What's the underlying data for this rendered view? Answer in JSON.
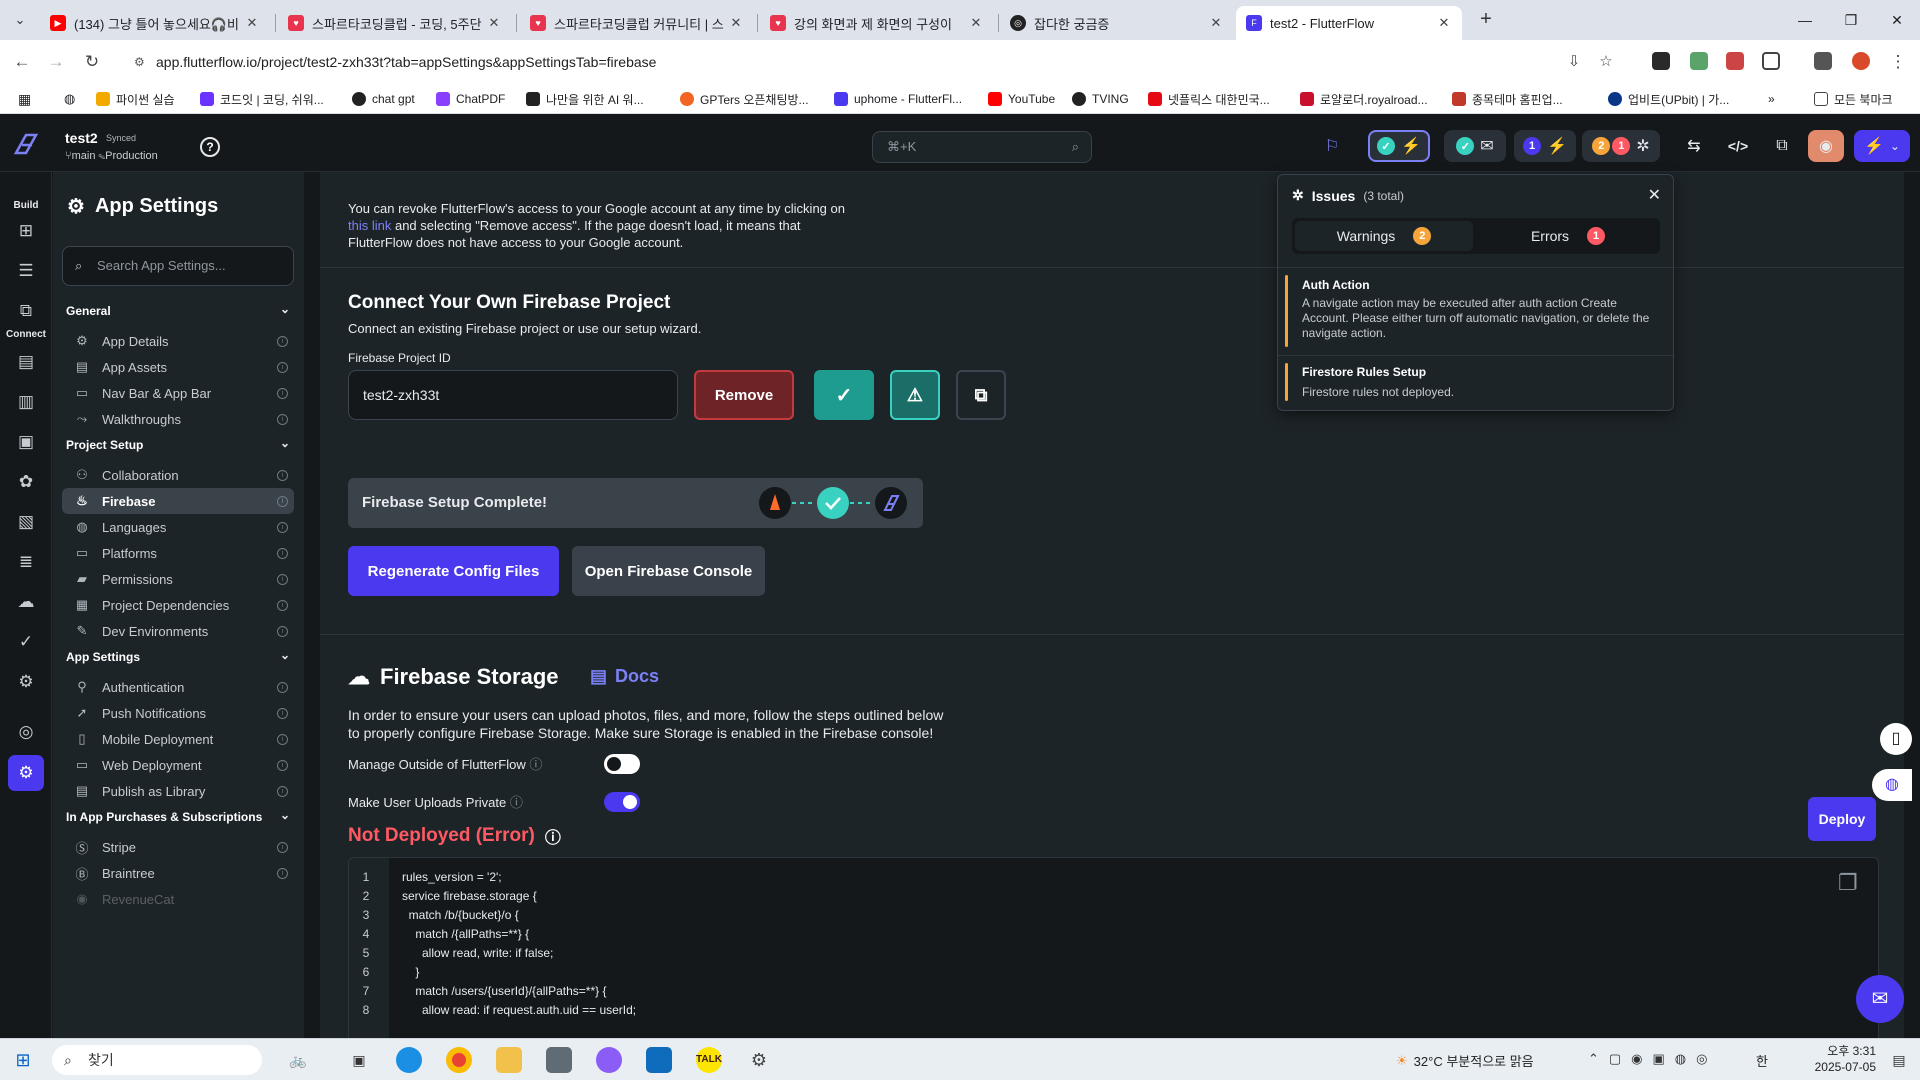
{
  "browser": {
    "tabs": [
      {
        "title": "(134) 그냥 틀어 놓으세요🎧비",
        "favicon": "youtube-icon"
      },
      {
        "title": "스파르타코딩클럽 - 코딩, 5주단",
        "favicon": "sparta-icon"
      },
      {
        "title": "스파르타코딩클럽 커뮤니티 | 스",
        "favicon": "sparta-icon"
      },
      {
        "title": "강의 화면과 제 화면의 구성이",
        "favicon": "sparta-icon"
      },
      {
        "title": "잡다한 궁금증",
        "favicon": "chatgpt-icon"
      },
      {
        "title": "test2 - FlutterFlow",
        "favicon": "flutterflow-icon"
      }
    ],
    "url": "app.flutterflow.io/project/test2-zxh33t?tab=appSettings&appSettingsTab=firebase",
    "bookmarks": [
      "파이썬 실습",
      "코드잇 | 코딩, 쉬워...",
      "chat gpt",
      "ChatPDF",
      "나만을 위한 AI 워...",
      "GPTers 오픈채팅방...",
      "uphome - FlutterFl...",
      "YouTube",
      "TVING",
      "넷플릭스 대한민국...",
      "로얄로더.royalroad...",
      "종목테마 홈핀업...",
      "업비트(UPbit) | 가...",
      "모든 북마크"
    ]
  },
  "topbar": {
    "project_name": "test2",
    "synced_label": "Synced",
    "branch_label": "main",
    "env_label": "Production",
    "search_shortcut": "⌘+K",
    "warnings_count": "2",
    "errors_count": "1",
    "notifications_count": "1"
  },
  "rail": {
    "build_label": "Build",
    "connect_label": "Connect"
  },
  "sidebar": {
    "title": "App Settings",
    "search_placeholder": "Search App Settings...",
    "sections": {
      "general": "General",
      "project_setup": "Project Setup",
      "app_settings": "App Settings",
      "purchases": "In App Purchases & Subscriptions"
    },
    "general_items": [
      "App Details",
      "App Assets",
      "Nav Bar & App Bar",
      "Walkthroughs"
    ],
    "project_items": [
      "Collaboration",
      "Firebase",
      "Languages",
      "Platforms",
      "Permissions",
      "Project Dependencies",
      "Dev Environments"
    ],
    "app_items": [
      "Authentication",
      "Push Notifications",
      "Mobile Deployment",
      "Web Deployment",
      "Publish as Library"
    ],
    "purchase_items": [
      "Stripe",
      "Braintree",
      "RevenueCat"
    ]
  },
  "main": {
    "revoke_text_1": "You can revoke FlutterFlow's access to your Google account at any time by clicking on",
    "revoke_link": "this link",
    "revoke_text_2": " and selecting \"Remove access\". If the page doesn't load, it means that",
    "revoke_text_3": "FlutterFlow does not have access to your Google account.",
    "connect_title": "Connect Your Own Firebase Project",
    "connect_subtitle": "Connect an existing Firebase project or use our setup wizard.",
    "project_id_label": "Firebase Project ID",
    "project_id_value": "test2-zxh33t",
    "remove_label": "Remove",
    "setup_complete_label": "Firebase Setup Complete!",
    "regenerate_label": "Regenerate Config Files",
    "open_console_label": "Open Firebase Console",
    "storage_title": "Firebase Storage",
    "docs_label": "Docs",
    "storage_desc_1": "In order to ensure your users can upload photos, files, and more, follow the steps outlined below",
    "storage_desc_2": "to properly configure Firebase Storage. Make sure Storage is enabled in the Firebase console!",
    "manage_outside_label": "Manage Outside of FlutterFlow",
    "manage_outside_on": false,
    "private_uploads_label": "Make User Uploads Private",
    "private_uploads_on": true,
    "deploy_status": "Not Deployed (Error)",
    "deploy_label": "Deploy",
    "code_lines": [
      "rules_version = '2';",
      "service firebase.storage {",
      "  match /b/{bucket}/o {",
      "    match /{allPaths=**} {",
      "      allow read, write: if false;",
      "    }",
      "    match /users/{userId}/{allPaths=**} {",
      "      allow read: if request.auth.uid == userId;"
    ]
  },
  "issues": {
    "title": "Issues",
    "total": "(3 total)",
    "tab_warnings": "Warnings",
    "tab_errors": "Errors",
    "warnings_count": "2",
    "errors_count": "1",
    "items": [
      {
        "title": "Auth Action",
        "desc": "A navigate action may be executed after auth action Create Account. Please either turn off automatic navigation, or delete the navigate action."
      },
      {
        "title": "Firestore Rules Setup",
        "desc": "Firestore rules not deployed."
      }
    ]
  },
  "taskbar": {
    "search_label": "찾기",
    "weather": "32°C  부분적으로 맑음",
    "time": "오후 3:31",
    "date": "2025-07-05",
    "ime": "한"
  },
  "colors": {
    "accent": "#4b39ef",
    "error": "#ff5963",
    "warning": "#f7a43b",
    "teal": "#39d2c0",
    "bg": "#14181b",
    "panel": "#1d2428"
  }
}
